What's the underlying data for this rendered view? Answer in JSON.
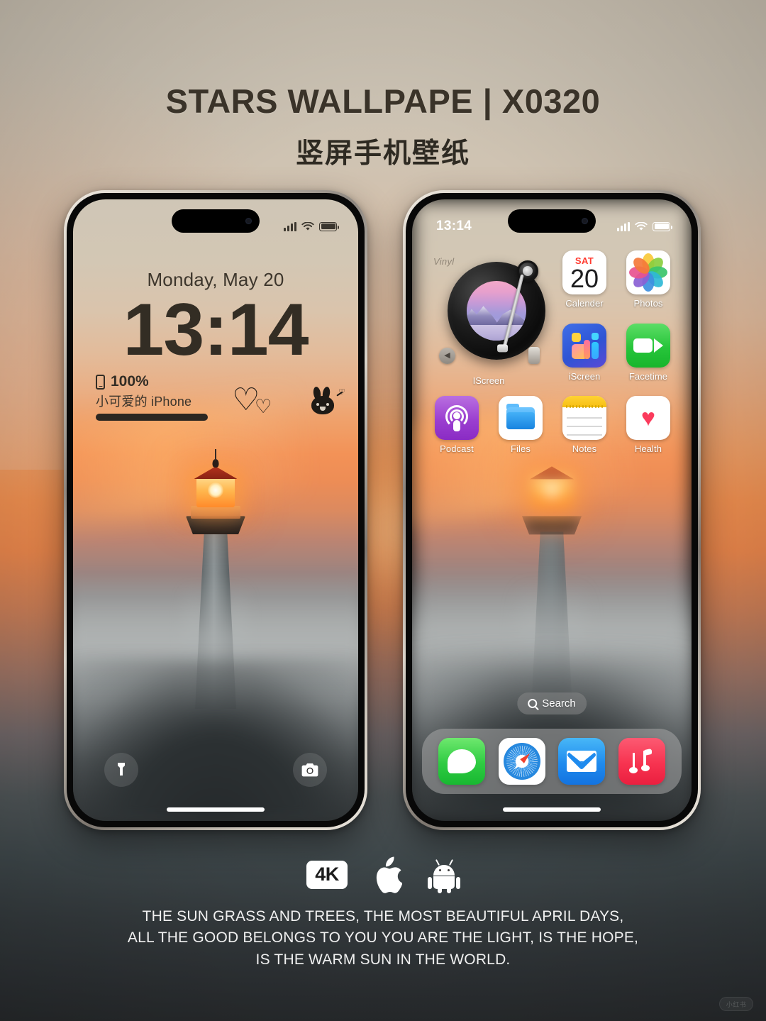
{
  "header": {
    "title": "STARS WALLPAPE | X0320",
    "subtitle": "竖屏手机壁纸"
  },
  "lock_screen": {
    "status_time": "",
    "date": "Monday, May 20",
    "time": "13:14",
    "battery_percent": "100%",
    "device_name": "小可爱的 iPhone",
    "sticker_heart": "♡",
    "sticker_heart_small": "♡",
    "sticker_bunny_heart": "♡",
    "flashlight_icon": "flashlight-icon",
    "camera_icon": "camera-icon"
  },
  "home_screen": {
    "status_time": "13:14",
    "widget": {
      "corner_text": "Vinyl",
      "label": "IScreen"
    },
    "apps": [
      {
        "label": "Calender",
        "icon": "calendar-icon",
        "day_of_week": "SAT",
        "day": "20"
      },
      {
        "label": "Photos",
        "icon": "photos-icon"
      },
      {
        "label": "iScreen",
        "icon": "iscreen-icon"
      },
      {
        "label": "Facetime",
        "icon": "facetime-icon"
      },
      {
        "label": "Podcast",
        "icon": "podcast-icon"
      },
      {
        "label": "Files",
        "icon": "files-icon"
      },
      {
        "label": "Notes",
        "icon": "notes-icon"
      },
      {
        "label": "Health",
        "icon": "health-icon"
      }
    ],
    "search": {
      "label": "Search",
      "icon": "magnifier-icon"
    },
    "dock": [
      {
        "label": "Messages",
        "icon": "messages-icon"
      },
      {
        "label": "Safari",
        "icon": "safari-icon"
      },
      {
        "label": "Mail",
        "icon": "mail-icon"
      },
      {
        "label": "Music",
        "icon": "music-icon"
      }
    ]
  },
  "footer": {
    "badge_4k": "4K",
    "apple_glyph": "",
    "caption_line1": "THE SUN GRASS AND TREES, THE MOST BEAUTIFUL APRIL DAYS,",
    "caption_line2": "ALL THE GOOD BELONGS TO YOU YOU ARE THE LIGHT, IS THE HOPE,",
    "caption_line3": "IS THE WARM SUN IN THE WORLD.",
    "watermark": "小红书"
  },
  "colors": {
    "title_text": "#3a3329",
    "caption_text": "#f0f0f0",
    "accent_orange": "#ef8c4e",
    "lock_text": "#332d24"
  }
}
